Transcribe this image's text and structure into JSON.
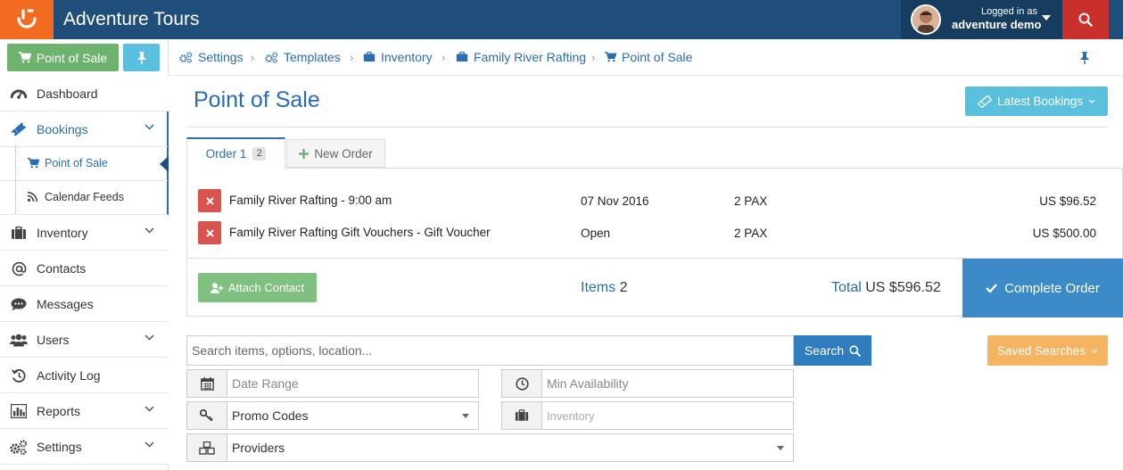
{
  "app": {
    "title": "Adventure Tours"
  },
  "user": {
    "logged_label": "Logged in as",
    "name": "adventure demo"
  },
  "sidebar": {
    "pos_button": "Point of Sale",
    "items": [
      {
        "label": "Dashboard",
        "icon": "dashboard-icon"
      },
      {
        "label": "Bookings",
        "icon": "ticket-icon"
      },
      {
        "label": "Inventory",
        "icon": "briefcase-icon"
      },
      {
        "label": "Contacts",
        "icon": "at-icon"
      },
      {
        "label": "Messages",
        "icon": "comment-icon"
      },
      {
        "label": "Users",
        "icon": "users-icon"
      },
      {
        "label": "Activity Log",
        "icon": "history-icon"
      },
      {
        "label": "Reports",
        "icon": "bar-chart-icon"
      },
      {
        "label": "Settings",
        "icon": "cogs-icon"
      }
    ],
    "sub_items": [
      {
        "label": "Point of Sale",
        "icon": "cart-icon"
      },
      {
        "label": "Calendar Feeds",
        "icon": "rss-icon"
      }
    ]
  },
  "breadcrumb": [
    "Settings",
    "Templates",
    "Inventory",
    "Family River Rafting",
    "Point of Sale"
  ],
  "page": {
    "title": "Point of Sale",
    "latest_bookings": "Latest Bookings"
  },
  "tabs": {
    "order_label": "Order 1",
    "order_count": "2",
    "new_order": "New Order"
  },
  "order": {
    "rows": [
      {
        "name": "Family River Rafting - 9:00 am",
        "date": "07 Nov 2016",
        "pax": "2 PAX",
        "price": "US $96.52"
      },
      {
        "name": "Family River Rafting Gift Vouchers - Gift Voucher",
        "date": "Open",
        "pax": "2 PAX",
        "price": "US $500.00"
      }
    ],
    "attach_contact": "Attach Contact",
    "items_label": "Items",
    "items_value": "2",
    "total_label": "Total",
    "total_value": "US $596.52",
    "complete": "Complete Order"
  },
  "search": {
    "placeholder": "Search items, options, location...",
    "button": "Search",
    "saved_searches": "Saved Searches"
  },
  "filters": {
    "date_range": "Date Range",
    "min_availability": "Min Availability",
    "promo_codes": "Promo Codes",
    "inventory": "Inventory",
    "providers": "Providers"
  },
  "colors": {
    "topbar": "#1e4e79",
    "logo": "#f26b21",
    "accent": "#2a6db0",
    "success": "#6db36d",
    "danger": "#d9534f",
    "info": "#5bc0de",
    "warning": "#f5b461",
    "primary": "#3d8ac8"
  }
}
